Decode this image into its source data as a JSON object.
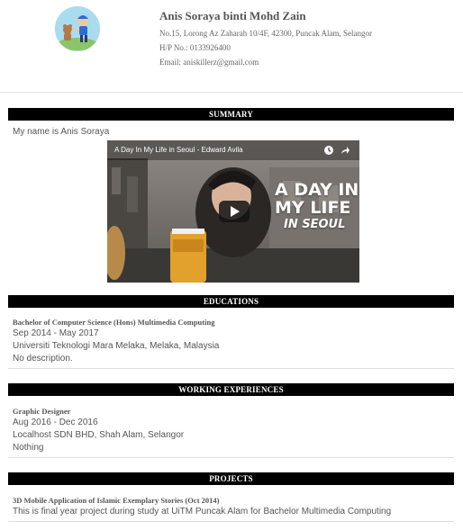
{
  "profile": {
    "name": "Anis Soraya binti Mohd Zain",
    "address": "No.15, Lorong Az Zaharah 10/4F, 42300, Puncak Alam, Selangor",
    "phone": "H/P No.: 0133926400",
    "email": "Email: aniskillerz@gmail.com",
    "avatar_icon": "cartoon-boy-avatar-icon"
  },
  "summary": {
    "heading": "SUMMARY",
    "text": "My name is Anis Soraya",
    "video": {
      "title": "A Day In My Life in Seoul - Edward Avila",
      "overlay_line1": "A DAY IN",
      "overlay_line2": "MY LIFE",
      "overlay_line3": "IN SEOUL",
      "play_icon": "play-icon",
      "watch_later_icon": "clock-icon",
      "share_icon": "share-arrow-icon"
    }
  },
  "educations": {
    "heading": "EDUCATIONS",
    "items": [
      {
        "title": "Bachelor of Computer Science (Hons) Multimedia Computing",
        "dates": "Sep 2014 - May 2017",
        "place": "Universiti Teknologi Mara Melaka, Melaka, Malaysia",
        "description": "No description."
      }
    ]
  },
  "experiences": {
    "heading": "WORKING EXPERIENCES",
    "items": [
      {
        "title": "Graphic Designer",
        "dates": "Aug 2016 - Dec 2016",
        "place": "Localhost SDN BHD, Shah Alam, Selangor",
        "description": "Nothing"
      }
    ]
  },
  "projects": {
    "heading": "PROJECTS",
    "items": [
      {
        "title": "3D Mobile Application of Islamic Exemplary Stories (Oct 2014)",
        "description": "This is final year project during study at UiTM Puncak Alam for Bachelor Multimedia Computing"
      }
    ]
  },
  "colors": {
    "section_bar": "#000000",
    "section_text": "#ffffff",
    "body_text": "#555555"
  }
}
